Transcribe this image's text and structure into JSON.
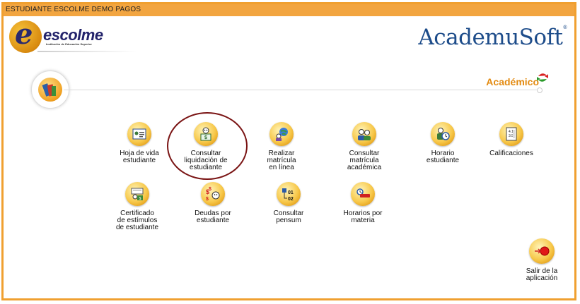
{
  "window": {
    "title": "ESTUDIANTE ESCOLME DEMO PAGOS"
  },
  "header": {
    "logo_text": "escolme",
    "logo_subtitle": "Institución de Educación Superior",
    "brand": "AcademuSoft"
  },
  "section": {
    "title": "Académico",
    "icon": "books-icon"
  },
  "menu_items": [
    {
      "label": "Hoja de vida\nestudiante",
      "icon": "id-card-icon"
    },
    {
      "label": "Consultar\nliquidación de\nestudiante",
      "icon": "invoice-icon"
    },
    {
      "label": "Realizar\nmatrícula\nen línea",
      "icon": "globe-user-icon"
    },
    {
      "label": "Consultar\nmatrícula\nacadémica",
      "icon": "users-icon"
    },
    {
      "label": "Horario\nestudiante",
      "icon": "clock-user-icon"
    },
    {
      "label": "Calificaciones",
      "icon": "grades-icon"
    },
    {
      "label": "Certificado\nde estímulos\nde estudiante",
      "icon": "certificate-icon"
    },
    {
      "label": "Deudas por\nestudiante",
      "icon": "debt-icon"
    },
    {
      "label": "Consultar\npensum",
      "icon": "pensum-icon"
    },
    {
      "label": "Horarios por\nmateria",
      "icon": "subject-schedule-icon"
    }
  ],
  "exit": {
    "label": "Salir de la\naplicación",
    "icon": "exit-icon"
  }
}
